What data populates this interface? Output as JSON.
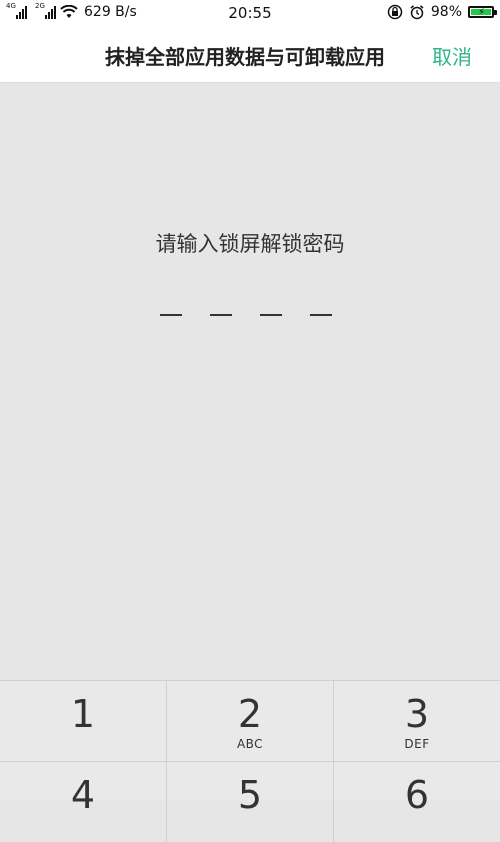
{
  "status_bar": {
    "net_tag_1": "4G",
    "net_tag_2": "2G",
    "speed": "629 B/s",
    "time": "20:55",
    "battery": "98%",
    "battery_level": 0.98,
    "battery_color": "#24c84a"
  },
  "header": {
    "title": "抹掉全部应用数据与可卸载应用",
    "cancel_label": "取消",
    "accent_color": "#2db48a"
  },
  "prompt": {
    "text": "请输入锁屏解锁密码",
    "pin_length": 4
  },
  "keypad": {
    "keys": [
      {
        "num": "1",
        "letters": ""
      },
      {
        "num": "2",
        "letters": "ABC"
      },
      {
        "num": "3",
        "letters": "DEF"
      },
      {
        "num": "4",
        "letters": ""
      },
      {
        "num": "5",
        "letters": ""
      },
      {
        "num": "6",
        "letters": ""
      }
    ]
  },
  "icons": [
    "signal-4g-icon",
    "signal-2g-icon",
    "wifi-icon",
    "lock-rotation-icon",
    "alarm-icon",
    "battery-icon"
  ]
}
